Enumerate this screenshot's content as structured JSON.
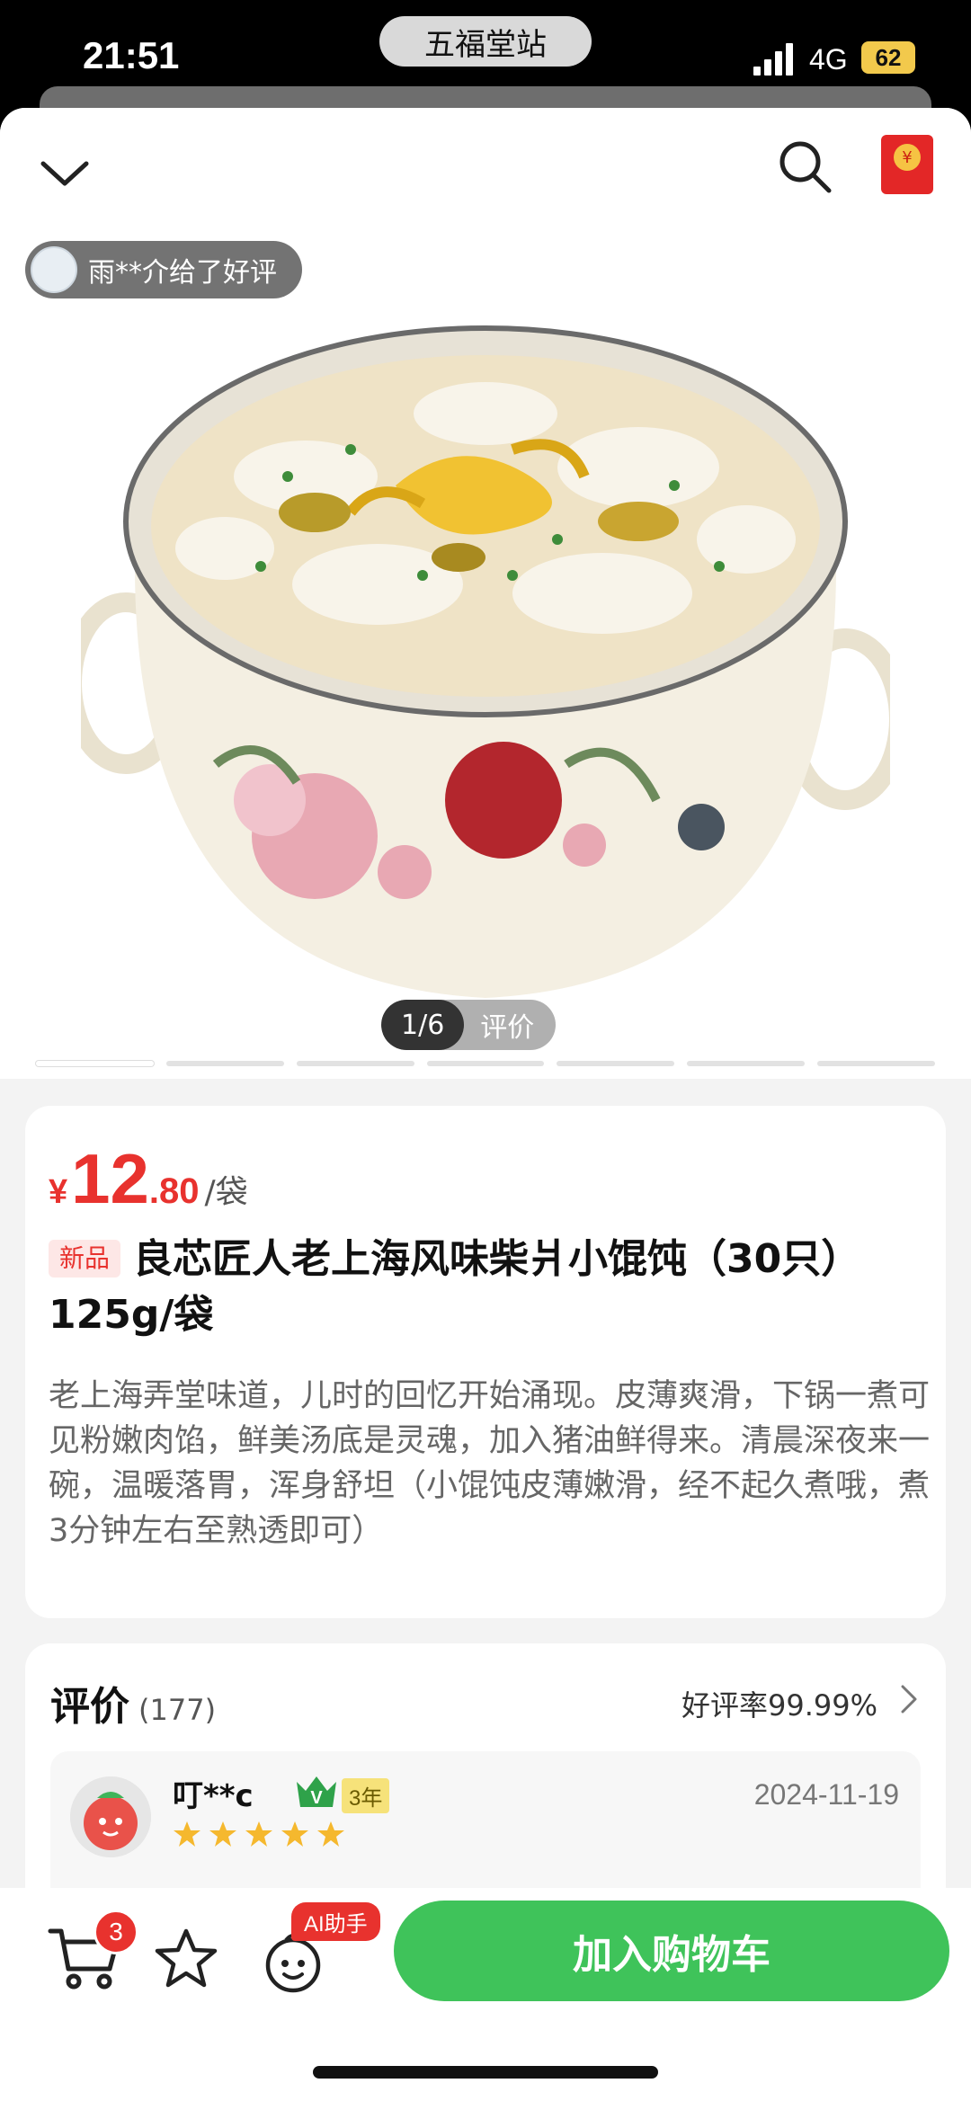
{
  "status_bar": {
    "time": "21:51",
    "island_label": "五福堂站",
    "network": "4G",
    "battery": "62"
  },
  "header": {
    "back_icon": "chevron-down-icon",
    "search_icon": "search-icon",
    "red_packet_icon": "red-packet-icon",
    "review_toast": "雨**介给了好评"
  },
  "gallery": {
    "page_indicator": "1/6",
    "review_tab": "评价",
    "total_pages": 6,
    "current_page": 1
  },
  "product": {
    "price_symbol": "¥",
    "price_int": "12",
    "price_dec": ".80",
    "price_unit": "/袋",
    "badge_new": "新品",
    "title": "良芯匠人老上海风味柴爿小馄饨（30只）125g/袋",
    "description": "老上海弄堂味道，儿时的回忆开始涌现。皮薄爽滑，下锅一煮可见粉嫩肉馅，鲜美汤底是灵魂，加入猪油鲜得来。清晨深夜来一碗，温暖落胃，浑身舒坦（小馄饨皮薄嫩滑，经不起久煮哦，煮3分钟左右至熟透即可）"
  },
  "reviews": {
    "heading": "评价",
    "count": "(177)",
    "good_rate": "好评率99.99%",
    "first": {
      "user": "叮**c",
      "member_years": "3年",
      "date": "2024-11-19",
      "stars": 5
    }
  },
  "bottom_bar": {
    "cart_count": "3",
    "ai_badge": "AI助手",
    "add_to_cart": "加入购物车"
  },
  "colors": {
    "accent_red": "#e8322e",
    "button_green": "#3fc35a",
    "star_gold": "#f5b82e"
  }
}
